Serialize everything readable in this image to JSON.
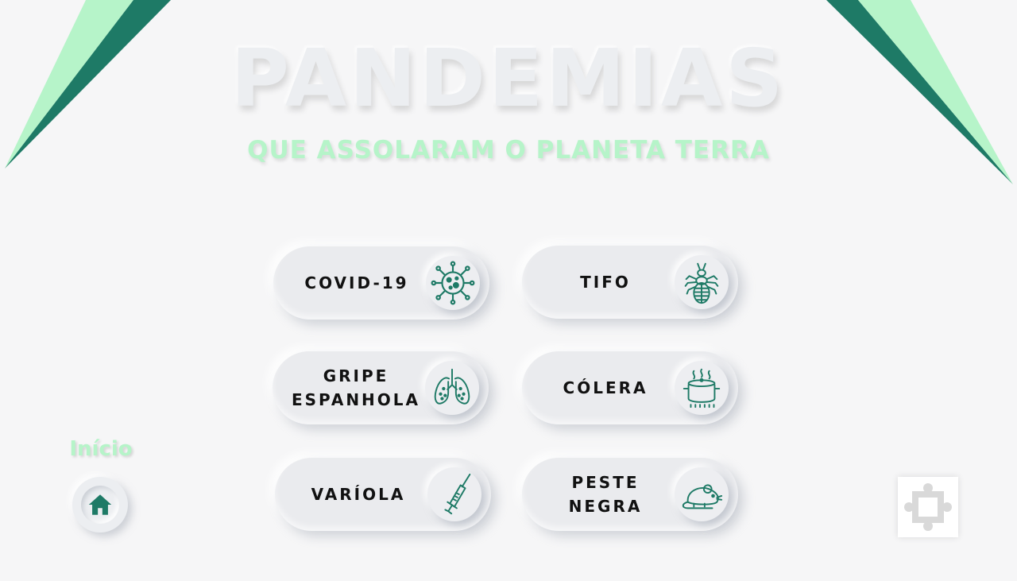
{
  "header": {
    "title": "PANDEMIAS",
    "subtitle": "QUE ASSOLARAM O PLANETA TERRA"
  },
  "colors": {
    "accent_dark": "#1e7a66",
    "accent_light": "#b6f4c9",
    "background": "#f6f6f7"
  },
  "pandemics": [
    {
      "label": "COVID-19",
      "icon": "virus-icon"
    },
    {
      "label": "TIFO",
      "icon": "louse-icon"
    },
    {
      "label_lines": [
        "GRIPE",
        "ESPANHOLA"
      ],
      "icon": "lungs-icon"
    },
    {
      "label": "CÓLERA",
      "icon": "cooking-pot-icon"
    },
    {
      "label": "VARÍOLA",
      "icon": "syringe-icon"
    },
    {
      "label_lines": [
        "PESTE",
        "NEGRA"
      ],
      "icon": "rat-icon"
    }
  ],
  "nav": {
    "home_label": "Início",
    "home_icon": "home-icon"
  },
  "extension": {
    "icon": "puzzle-icon"
  }
}
